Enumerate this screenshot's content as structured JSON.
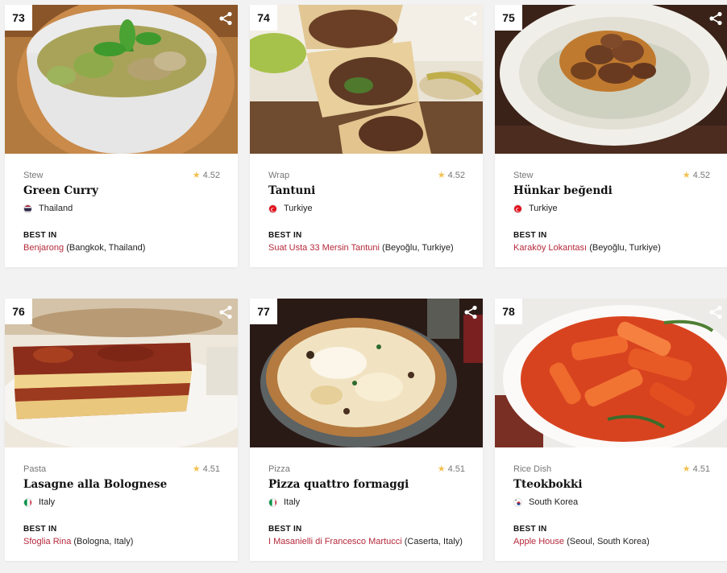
{
  "cards": [
    {
      "rank": "73",
      "type": "Stew",
      "rating": "4.52",
      "name": "Green Curry",
      "country": "Thailand",
      "best_in_label": "BEST IN",
      "restaurant": "Benjarong",
      "location": "(Bangkok, Thailand)",
      "flag": "thailand-flag",
      "image": "green-curry-photo"
    },
    {
      "rank": "74",
      "type": "Wrap",
      "rating": "4.52",
      "name": "Tantuni",
      "country": "Turkiye",
      "best_in_label": "BEST IN",
      "restaurant": "Suat Usta 33 Mersin Tantuni",
      "location": "(Beyoğlu, Turkiye)",
      "flag": "turkey-flag",
      "image": "tantuni-photo"
    },
    {
      "rank": "75",
      "type": "Stew",
      "rating": "4.52",
      "name": "Hünkar beğendi",
      "country": "Turkiye",
      "best_in_label": "BEST IN",
      "restaurant": "Karaköy Lokantası",
      "location": "(Beyoğlu, Turkiye)",
      "flag": "turkey-flag",
      "image": "hunkar-begendi-photo"
    },
    {
      "rank": "76",
      "type": "Pasta",
      "rating": "4.51",
      "name": "Lasagne alla Bolognese",
      "country": "Italy",
      "best_in_label": "BEST IN",
      "restaurant": "Sfoglia Rina",
      "location": "(Bologna, Italy)",
      "flag": "italy-flag",
      "image": "lasagne-photo"
    },
    {
      "rank": "77",
      "type": "Pizza",
      "rating": "4.51",
      "name": "Pizza quattro formaggi",
      "country": "Italy",
      "best_in_label": "BEST IN",
      "restaurant": "I Masanielli di Francesco Martucci",
      "location": "(Caserta, Italy)",
      "flag": "italy-flag",
      "image": "pizza-photo"
    },
    {
      "rank": "78",
      "type": "Rice Dish",
      "rating": "4.51",
      "name": "Tteokbokki",
      "country": "South Korea",
      "best_in_label": "BEST IN",
      "restaurant": "Apple House",
      "location": "(Seoul, South Korea)",
      "flag": "south-korea-flag",
      "image": "tteokbokki-photo"
    }
  ],
  "icons": {
    "share": "share-icon",
    "star": "star-icon"
  },
  "colors": {
    "accent": "#b5293c",
    "star": "#f2c14e"
  }
}
